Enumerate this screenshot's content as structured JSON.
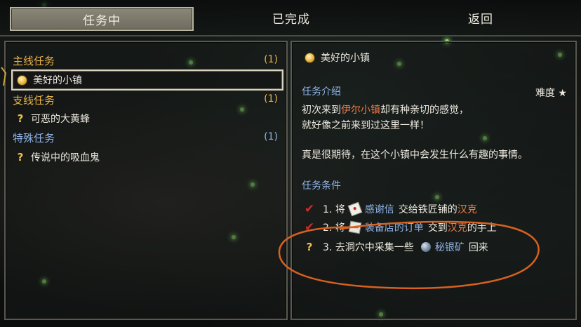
{
  "tabs": [
    {
      "label": "任务中",
      "active": true
    },
    {
      "label": "已完成",
      "active": false
    },
    {
      "label": "返回",
      "active": false
    }
  ],
  "quest_list": {
    "main": {
      "label": "主线任务",
      "count": "(1)",
      "items": [
        "美好的小镇"
      ]
    },
    "side": {
      "label": "支线任务",
      "count": "(1)",
      "items": [
        "可恶的大黄蜂"
      ]
    },
    "special": {
      "label": "特殊任务",
      "count": "(1)",
      "items": [
        "传说中的吸血鬼"
      ]
    }
  },
  "detail": {
    "title": "美好的小镇",
    "intro_label": "任务介绍",
    "difficulty": "难度 ★",
    "desc_line1_a": "初次来到",
    "desc_line1_town": "伊尔小镇",
    "desc_line1_b": "却有种亲切的感觉，",
    "desc_line2": "就好像之前来到过这里一样！",
    "desc_line3": "真是很期待，在这个小镇中会发生什么有趣的事情。",
    "conditions_label": "任务条件",
    "conditions": [
      {
        "status": "done",
        "prefix": "1. 将",
        "item": "感谢信",
        "mid": "交给铁匠铺的",
        "npc": "汉克",
        "suffix": ""
      },
      {
        "status": "done",
        "prefix": "2. 将",
        "item": "装备店的订单",
        "mid": "交到",
        "npc": "汉克",
        "suffix": "的手上"
      },
      {
        "status": "pending",
        "prefix": "3. 去洞穴中采集一些",
        "item": "秘银矿",
        "mid": "回来",
        "npc": "",
        "suffix": ""
      }
    ]
  },
  "icons": {
    "check": "red-check-icon",
    "pending": "question-mark-icon",
    "quest_coin": "gold-coin-icon"
  },
  "colors": {
    "category_gold": "#e8b14a",
    "category_blue": "#8fb3e8",
    "highlight_orange": "#f07a45",
    "check_red": "#d12a2a",
    "annotation_orange": "#d8611f"
  }
}
